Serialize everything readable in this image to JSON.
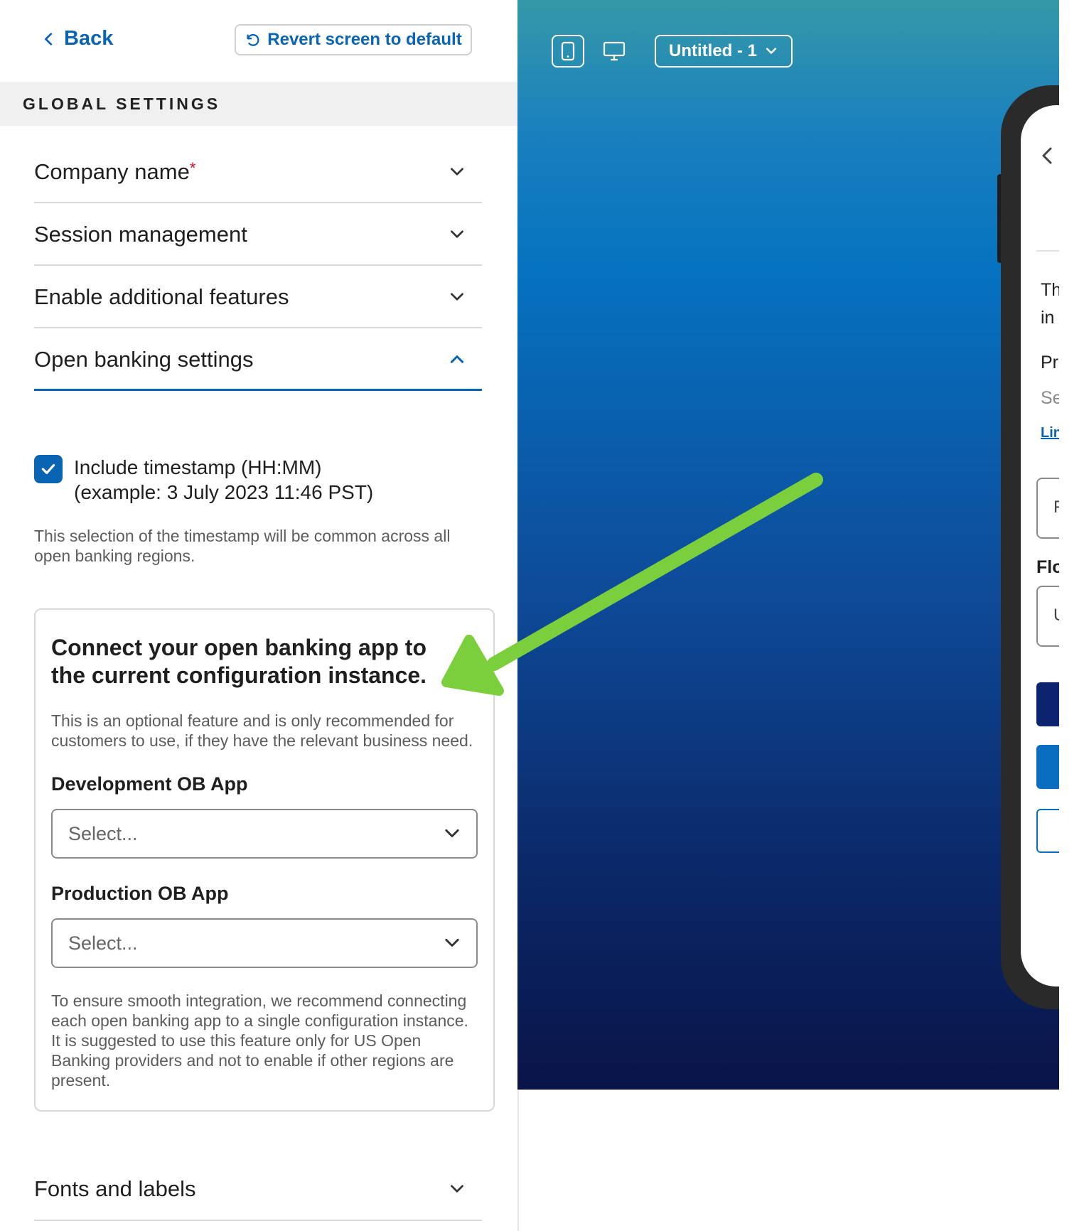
{
  "header": {
    "back_label": "Back",
    "revert_label": "Revert screen to default"
  },
  "section": {
    "title": "GLOBAL SETTINGS"
  },
  "accordion": [
    {
      "label": "Company name",
      "required_mark": "*",
      "state": "collapsed"
    },
    {
      "label": "Session management",
      "state": "collapsed"
    },
    {
      "label": "Enable additional features",
      "state": "collapsed"
    },
    {
      "label": "Open banking settings",
      "state": "expanded"
    }
  ],
  "open_banking": {
    "checkbox_checked": true,
    "checkbox_line1": "Include timestamp (HH:MM)",
    "checkbox_line2": "(example: 3 July 2023 11:46 PST)",
    "helper": "This selection of the timestamp will be common across all open banking regions.",
    "card": {
      "title": "Connect your open banking app to the current configuration instance.",
      "description": "This is an optional feature and is only recommended for customers to use, if they have the relevant business need.",
      "dev_label": "Development OB App",
      "dev_placeholder": "Select...",
      "prod_label": "Production OB App",
      "prod_placeholder": "Select...",
      "note": "To ensure smooth integration, we recommend connecting each open banking app to a single configuration instance. It is suggested to use this feature only for US Open Banking providers and not to enable if other regions are present."
    }
  },
  "fonts_section": {
    "label": "Fonts and labels"
  },
  "preview": {
    "version_label": "Untitled - 1",
    "phone_text": {
      "line1": "This",
      "line2": "in v",
      "line3": "Pri",
      "line4": "Se",
      "link": "Lin",
      "input1": "F",
      "label2": "Flo",
      "input2": "Us"
    }
  },
  "colors": {
    "accent": "#0a64b4",
    "arrow": "#7ccf3c",
    "required": "#c8102e",
    "dark_button": "#0c2470",
    "primary_button": "#0a6ec0"
  },
  "icons": [
    "chevron-left-icon",
    "undo-icon",
    "chevron-down-icon",
    "chevron-up-icon",
    "check-icon",
    "mobile-icon",
    "desktop-icon"
  ]
}
